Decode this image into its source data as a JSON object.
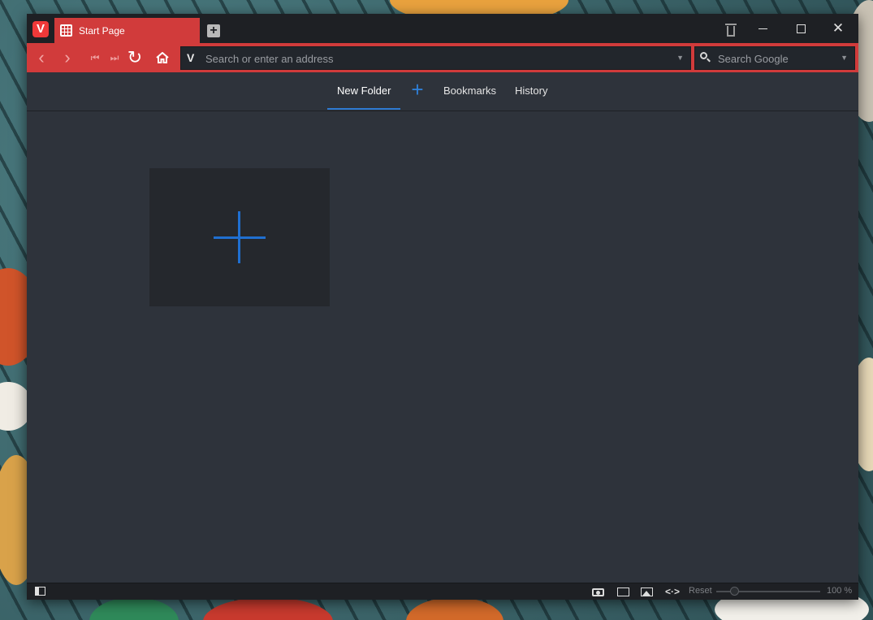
{
  "tab": {
    "title": "Start Page"
  },
  "addressbar": {
    "url_placeholder": "Search or enter an address",
    "search_placeholder": "Search Google"
  },
  "start_page": {
    "nav": {
      "new_folder": "New Folder",
      "add": "+",
      "bookmarks": "Bookmarks",
      "history": "History"
    }
  },
  "statusbar": {
    "reset_label": "Reset",
    "zoom_value": "100 %"
  },
  "colors": {
    "accent_red": "#d13b3b",
    "speed_dial_plus": "#1f6fd0",
    "page_background": "#2e333b"
  },
  "icons": {
    "logo": "vivaldi-logo",
    "new_tab": "plus-square-icon",
    "trash": "trash-icon",
    "back": "chevron-left-icon",
    "forward": "chevron-right-icon",
    "rewind": "skip-back-icon",
    "fast_forward": "skip-forward-icon",
    "reload": "reload-icon",
    "home": "home-icon",
    "search": "search-icon",
    "capture": "camera-icon",
    "tiling": "window-icon",
    "images": "image-icon",
    "page_actions": "code-icon",
    "panel": "panel-toggle-icon"
  }
}
